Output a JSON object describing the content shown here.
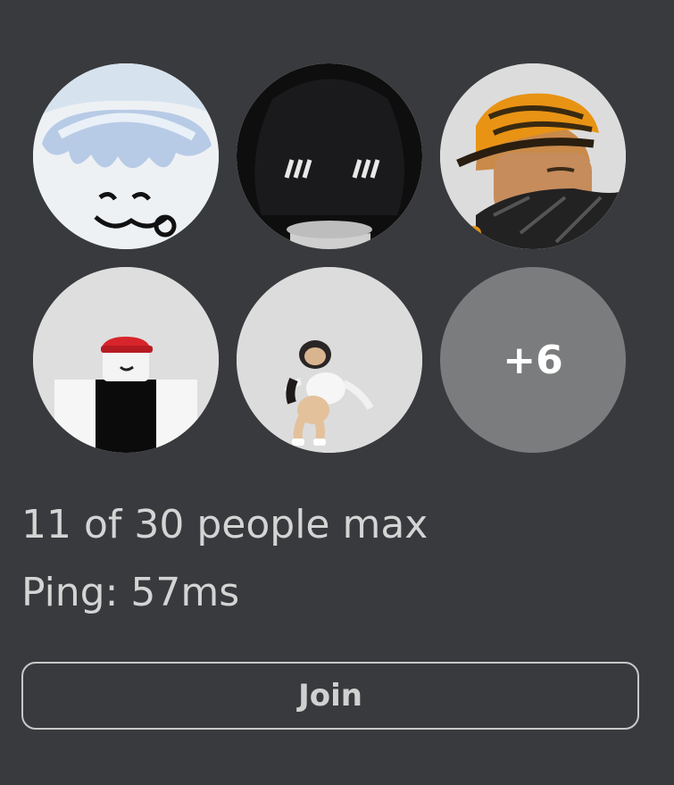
{
  "server": {
    "avatars": [
      {
        "icon": "player-avatar-white-hair"
      },
      {
        "icon": "player-avatar-black-hair"
      },
      {
        "icon": "player-avatar-bandana-hat"
      },
      {
        "icon": "player-avatar-red-cap"
      },
      {
        "icon": "player-avatar-dancing-girl"
      }
    ],
    "more_count": "+6",
    "players_text": "11 of 30 people max",
    "ping_text": "Ping: 57ms",
    "join_label": "Join"
  },
  "colors": {
    "background": "#393a3d",
    "more_badge": "#7b7c7e",
    "text": "#d4d4d4",
    "button_border": "#c9c9c9"
  }
}
